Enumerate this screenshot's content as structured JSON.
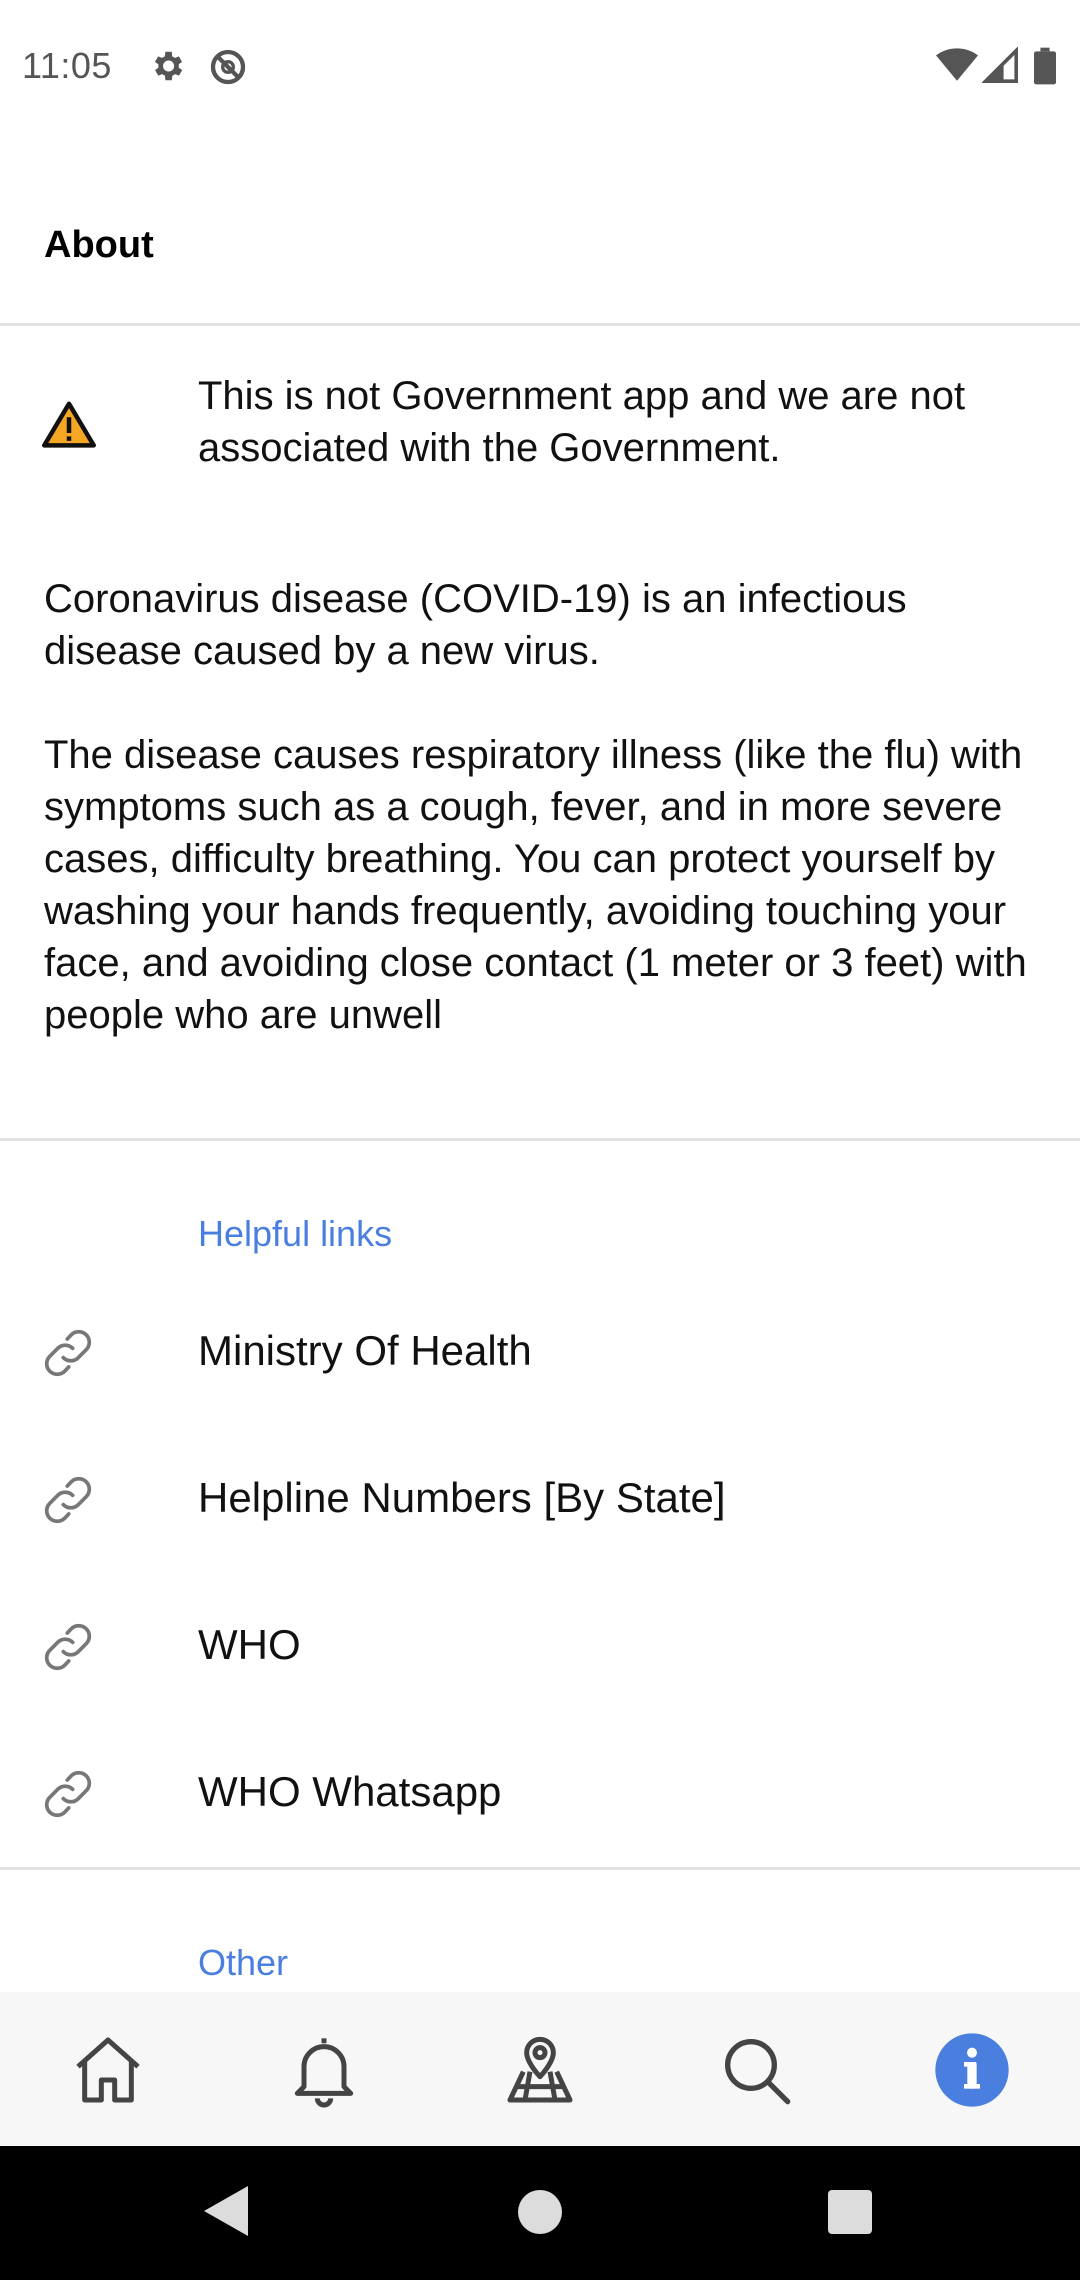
{
  "status_bar": {
    "time": "11:05",
    "icons": [
      "gear-icon",
      "no-sync-icon",
      "wifi-icon",
      "cellular-signal-icon",
      "battery-icon"
    ]
  },
  "header": {
    "title": "About"
  },
  "notice": {
    "icon": "warning-icon",
    "text": "This is not Government app and we are not associated with the Government."
  },
  "about": {
    "paragraph_1": "Coronavirus disease (COVID-19) is an infectious disease caused by a new virus.",
    "paragraph_2": "The disease causes respiratory illness (like the flu) with symptoms such as a cough, fever, and in more severe cases, difficulty breathing. You can protect yourself by washing your hands frequently, avoiding touching your face, and avoiding close contact (1 meter or 3 feet) with people who are unwell"
  },
  "helpful_links": {
    "title": "Helpful links",
    "items": [
      {
        "icon": "link-icon",
        "label": "Ministry Of Health"
      },
      {
        "icon": "link-icon",
        "label": "Helpline Numbers [By State]"
      },
      {
        "icon": "link-icon",
        "label": "WHO"
      },
      {
        "icon": "link-icon",
        "label": "WHO Whatsapp"
      }
    ]
  },
  "other": {
    "title": "Other"
  },
  "bottom_nav": {
    "items": [
      "home-icon",
      "bell-icon",
      "map-pin-icon",
      "search-icon",
      "info-icon"
    ],
    "active": "info-icon"
  },
  "system_nav": {
    "items": [
      "back-icon",
      "home-circle-icon",
      "recents-icon"
    ]
  },
  "colors": {
    "accent": "#4a7fe0",
    "warning": "#f5a623",
    "divider": "#e2e2e2"
  }
}
